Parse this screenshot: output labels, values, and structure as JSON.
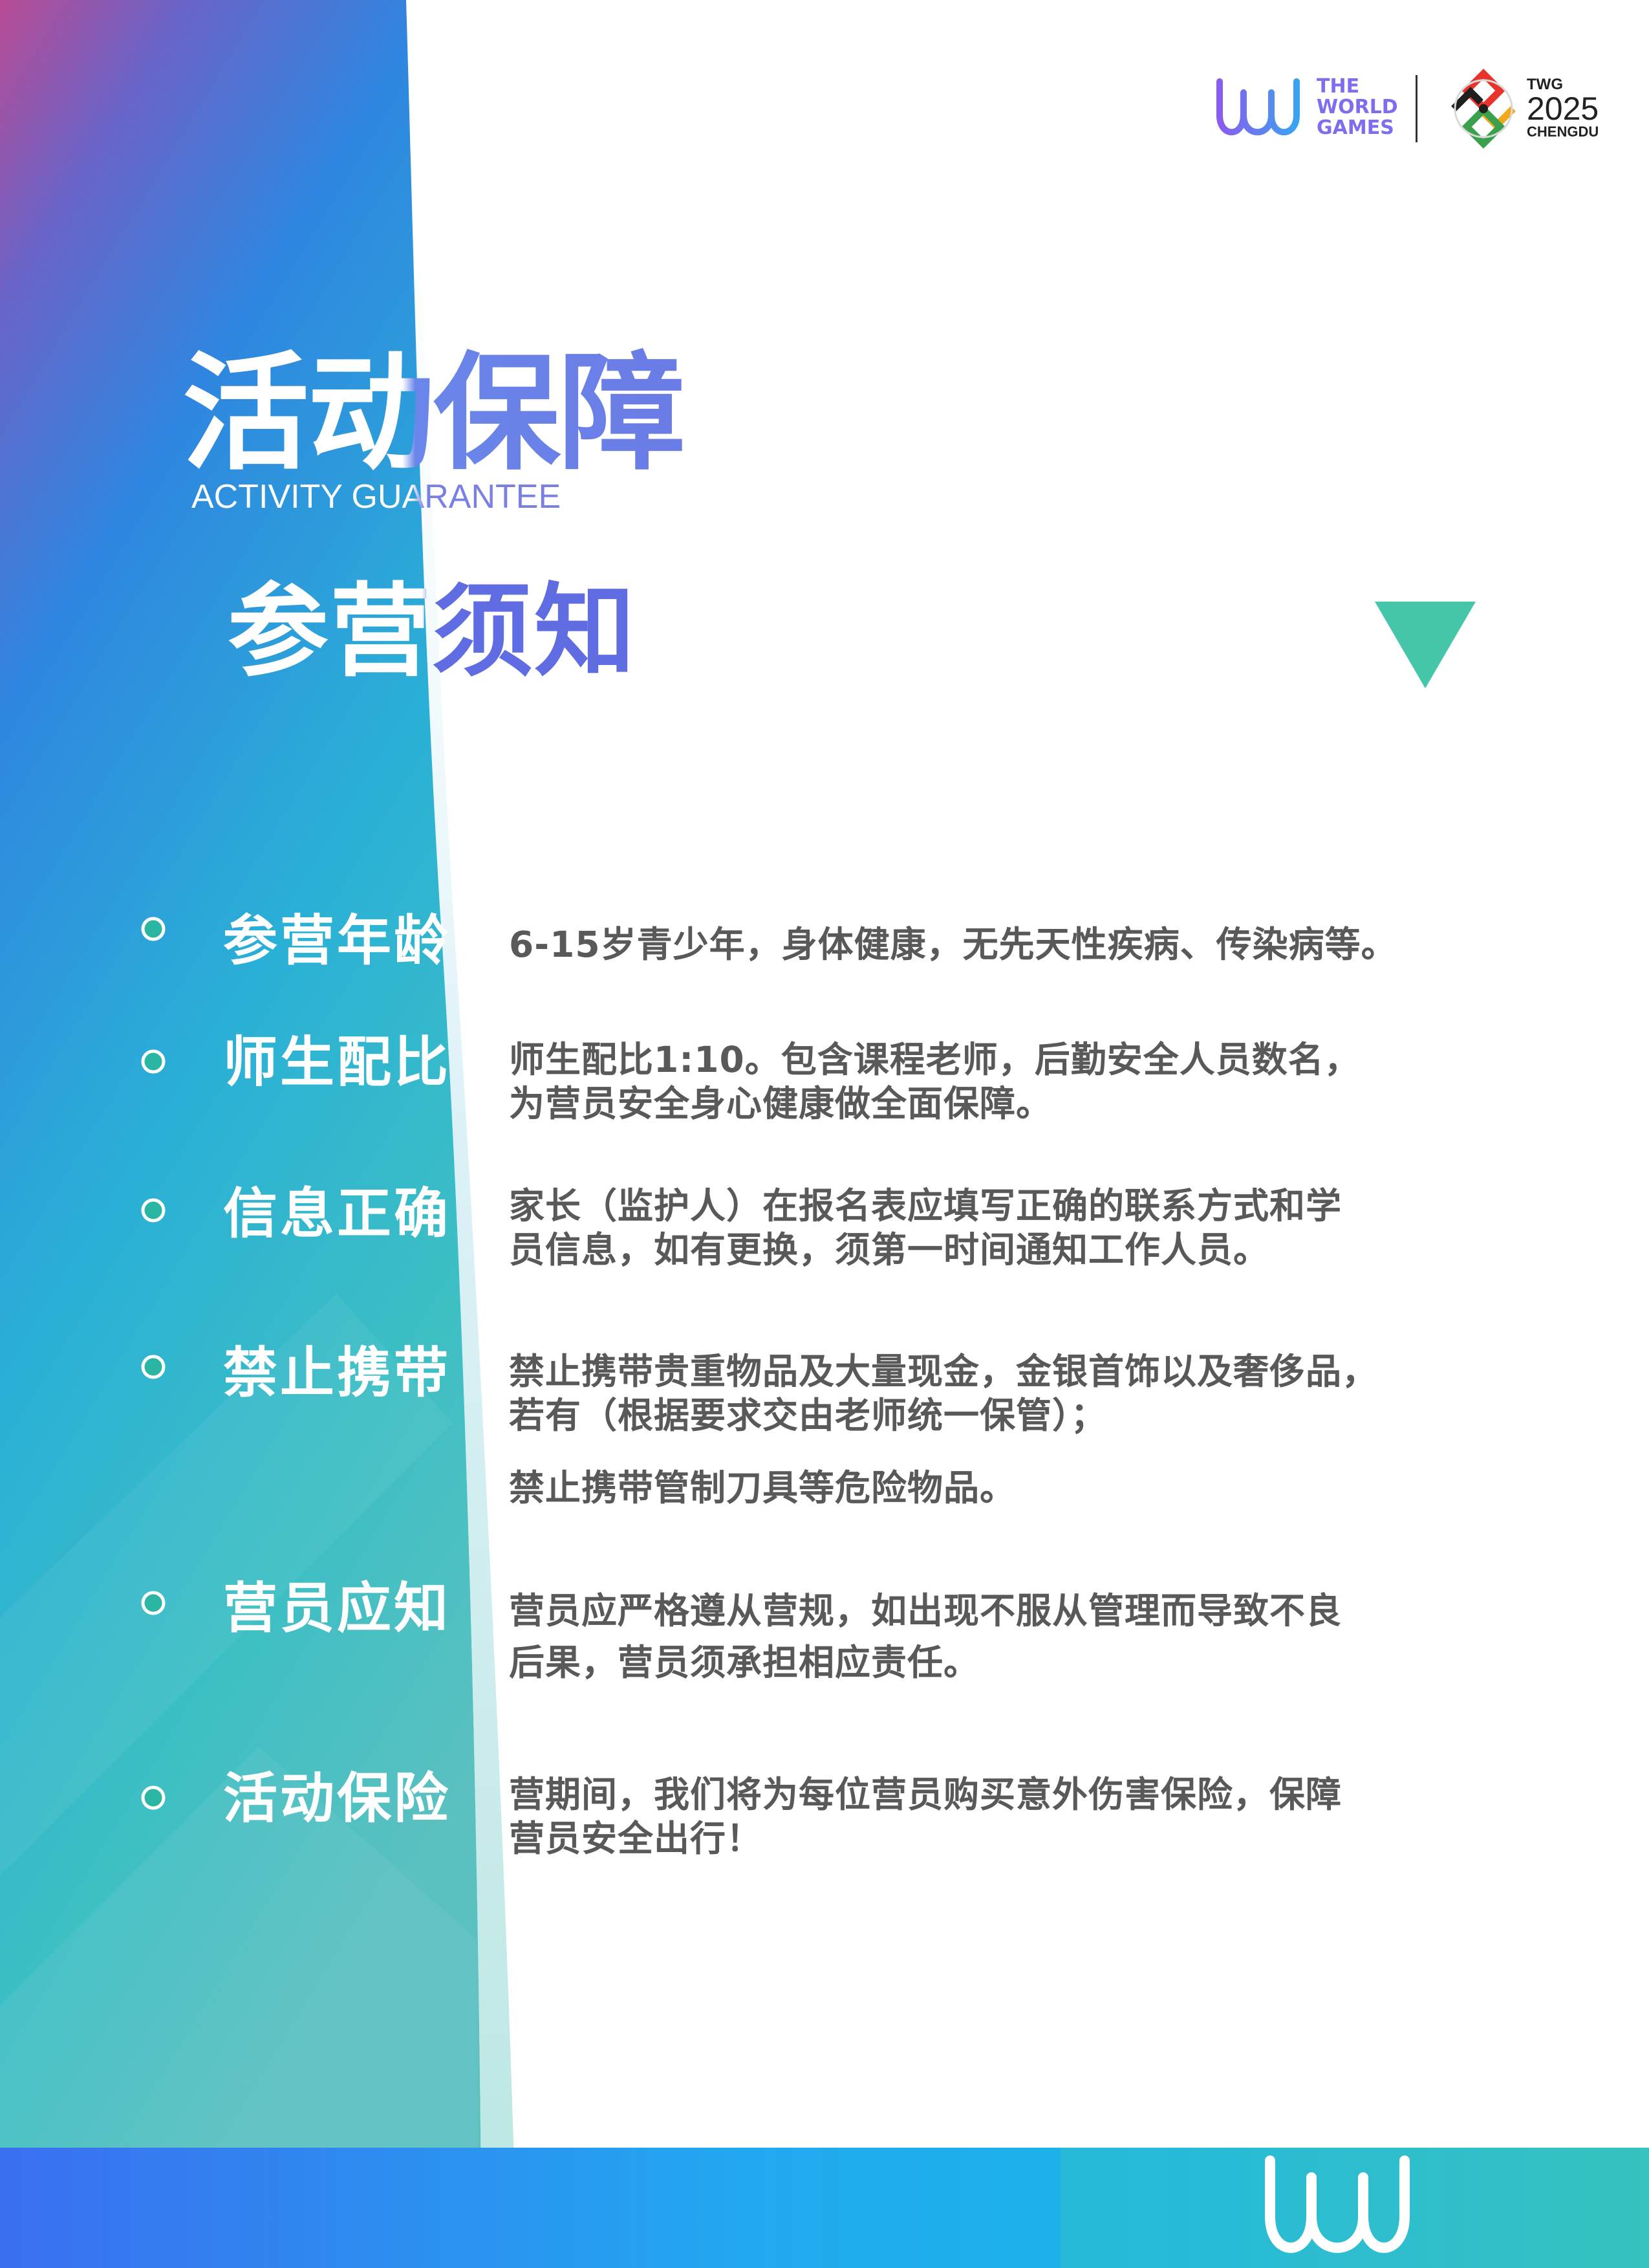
{
  "header": {
    "logo_worldgames": {
      "lines": [
        "THE",
        "WORLD",
        "GAMES"
      ]
    },
    "logo_twg": {
      "top": "TWG",
      "year": "2025",
      "city": "CHENGDU"
    }
  },
  "title": {
    "main": "活动保障",
    "sub": "ACTIVITY GUARANTEE"
  },
  "section": {
    "title": "参营须知"
  },
  "items": [
    {
      "label": "参营年龄",
      "lines": [
        "6-15岁青少年，身体健康，无先天性疾病、传染病等。"
      ]
    },
    {
      "label": "师生配比",
      "lines": [
        "师生配比1:10。包含课程老师，后勤安全人员数名，",
        "为营员安全身心健康做全面保障。"
      ]
    },
    {
      "label": "信息正确",
      "lines": [
        "家长（监护人）在报名表应填写正确的联系方式和学",
        "员信息，如有更换，须第一时间通知工作人员。"
      ]
    },
    {
      "label": "禁止携带",
      "lines": [
        "禁止携带贵重物品及大量现金，金银首饰以及奢侈品，",
        "若有（根据要求交由老师统一保管）；",
        "禁止携带管制刀具等危险物品。"
      ]
    },
    {
      "label": "营员应知",
      "lines": [
        "营员应严格遵从营规，如出现不服从管理而导致不良",
        "后果，营员须承担相应责任。"
      ]
    },
    {
      "label": "活动保险",
      "lines": [
        "营期间，我们将为每位营员购买意外伤害保险，保障",
        "营员安全出行！"
      ]
    }
  ],
  "colors": {
    "bullet": "#2bb5a3",
    "triangle": "#45c6a8",
    "label_text": "#ffffff",
    "body_text": "#595959"
  }
}
